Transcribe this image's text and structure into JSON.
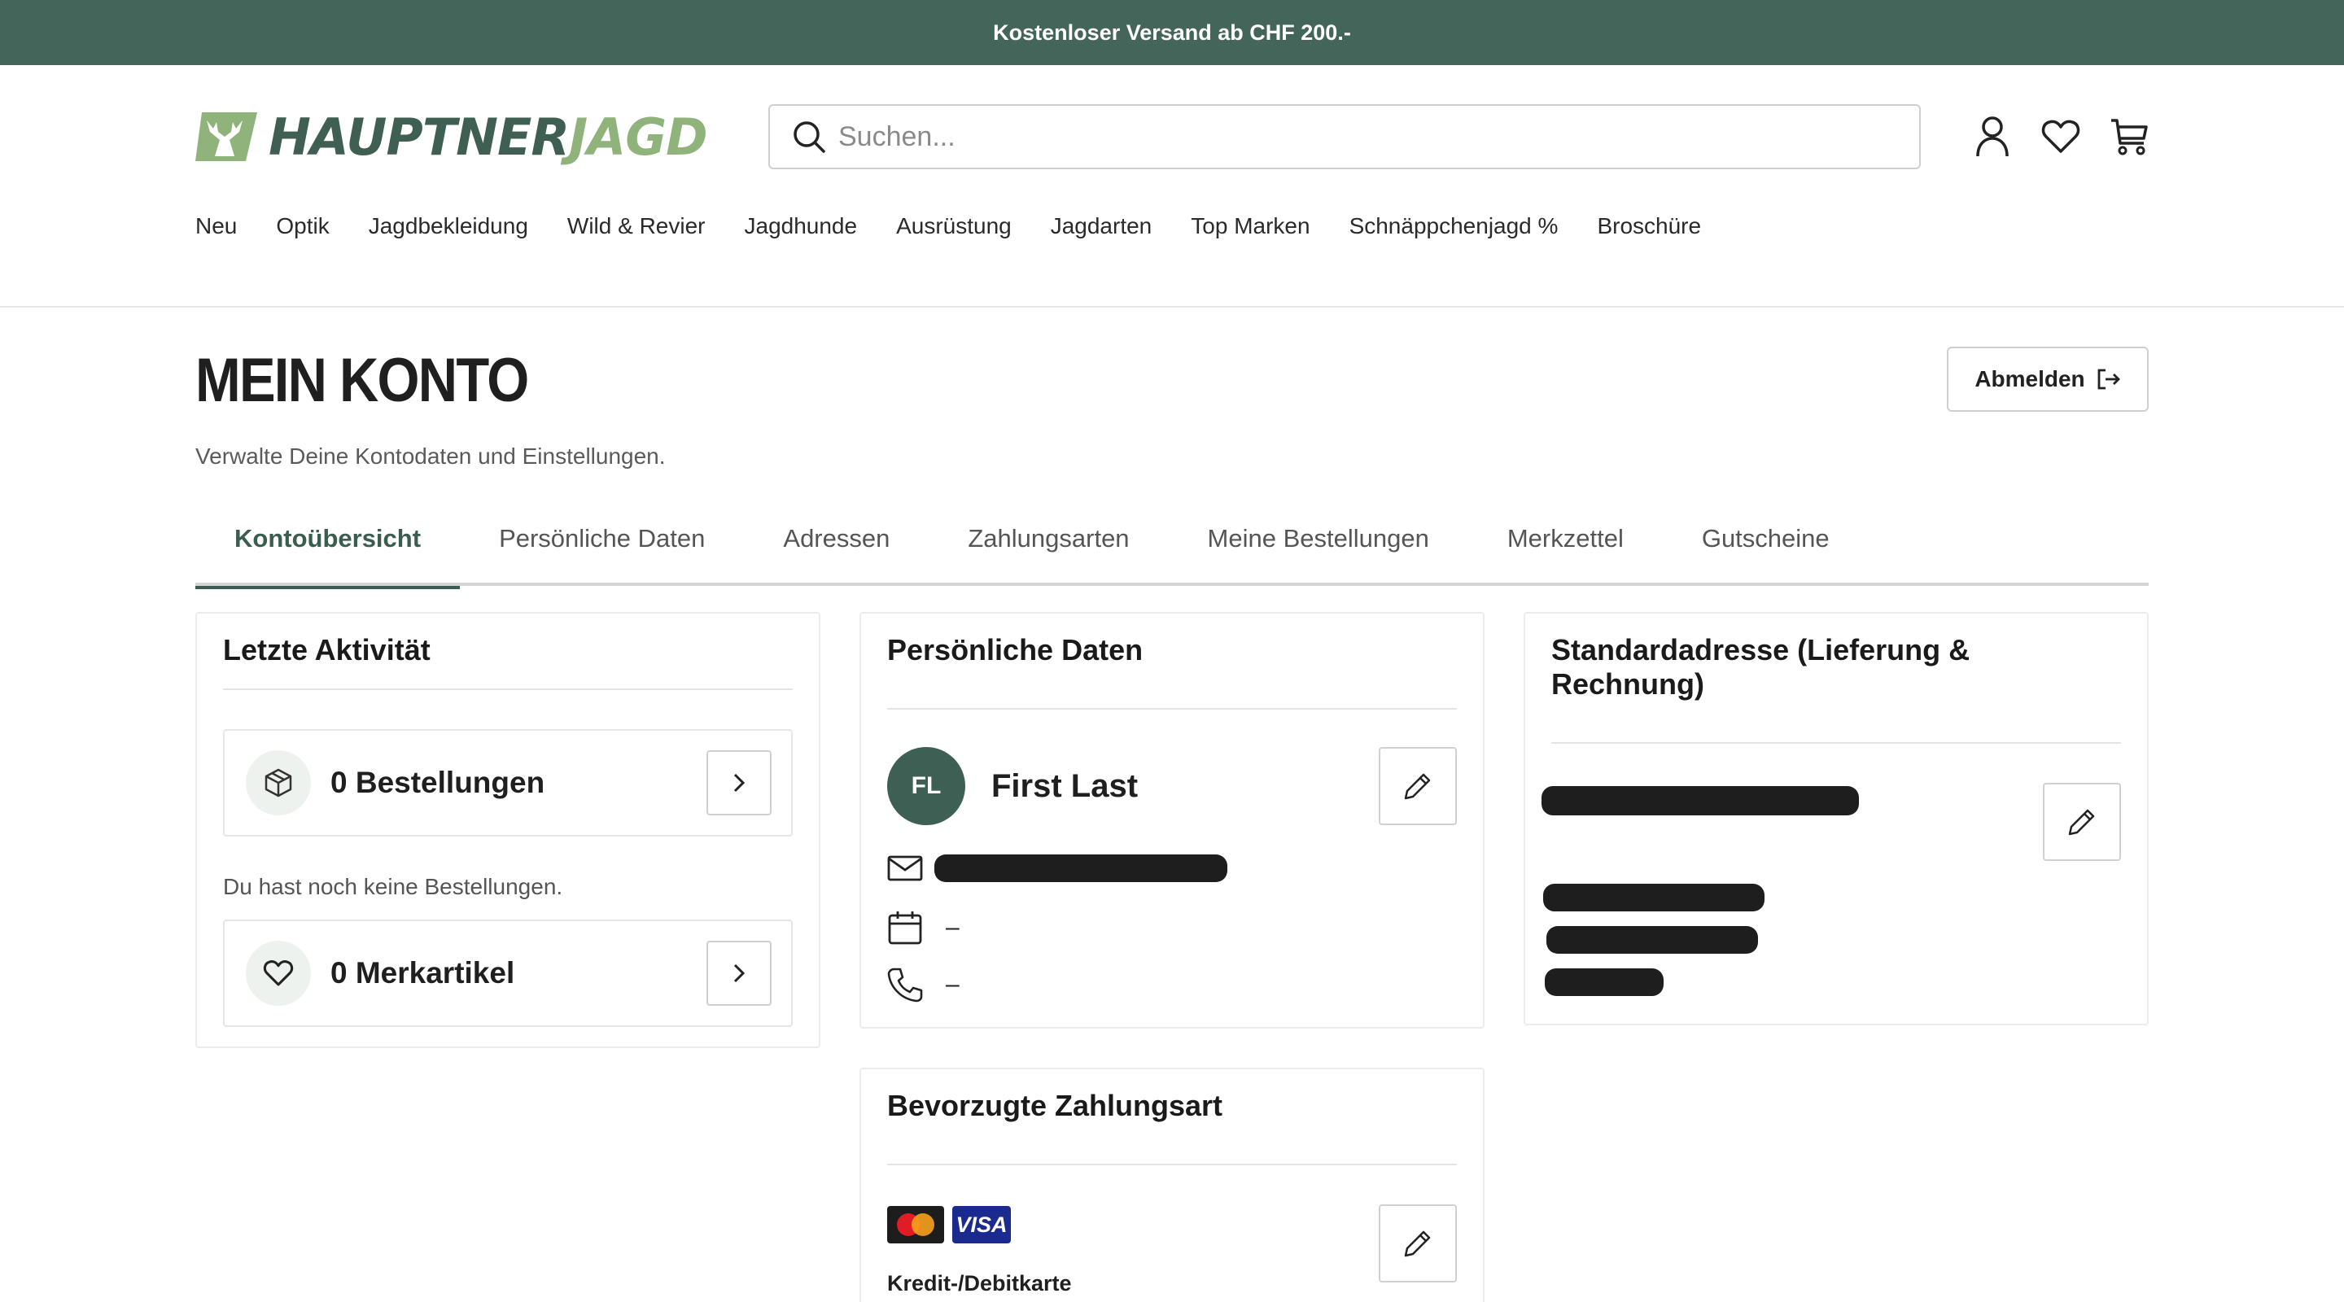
{
  "promo": {
    "text": "Kostenloser Versand ab CHF 200.-"
  },
  "header": {
    "logo_part1": "HAUPTNER",
    "logo_part2": "JAGD",
    "search_placeholder": "Suchen...",
    "icons": [
      "user-icon",
      "heart-icon",
      "cart-icon"
    ]
  },
  "nav": {
    "items": [
      "Neu",
      "Optik",
      "Jagdbekleidung",
      "Wild & Revier",
      "Jagdhunde",
      "Ausrüstung",
      "Jagdarten",
      "Top Marken",
      "Schnäppchenjagd %",
      "Broschüre"
    ]
  },
  "account": {
    "title": "MEIN KONTO",
    "subtitle": "Verwalte Deine Kontodaten und Einstellungen.",
    "logout_label": "Abmelden"
  },
  "tabs": {
    "items": [
      "Kontoübersicht",
      "Persönliche Daten",
      "Adressen",
      "Zahlungsarten",
      "Meine Bestellungen",
      "Merkzettel",
      "Gutscheine"
    ],
    "active": "Kontoübersicht"
  },
  "activity": {
    "title": "Letzte Aktivität",
    "orders_label": "0 Bestellungen",
    "orders_note": "Du hast noch keine Bestellungen.",
    "wishlist_label": "0 Merkartikel"
  },
  "personal": {
    "title": "Persönliche Daten",
    "initials": "FL",
    "name": "First Last",
    "birthday": "–",
    "phone": "–"
  },
  "address": {
    "title": "Standardadresse (Lieferung & Rechnung)"
  },
  "payment": {
    "title": "Bevorzugte Zahlungsart",
    "method_label": "Kredit-/Debitkarte",
    "visa_text": "VISA"
  },
  "colors": {
    "brand_dark": "#44665a",
    "brand_light": "#8fb37b",
    "active_tab": "#3b5d50"
  }
}
